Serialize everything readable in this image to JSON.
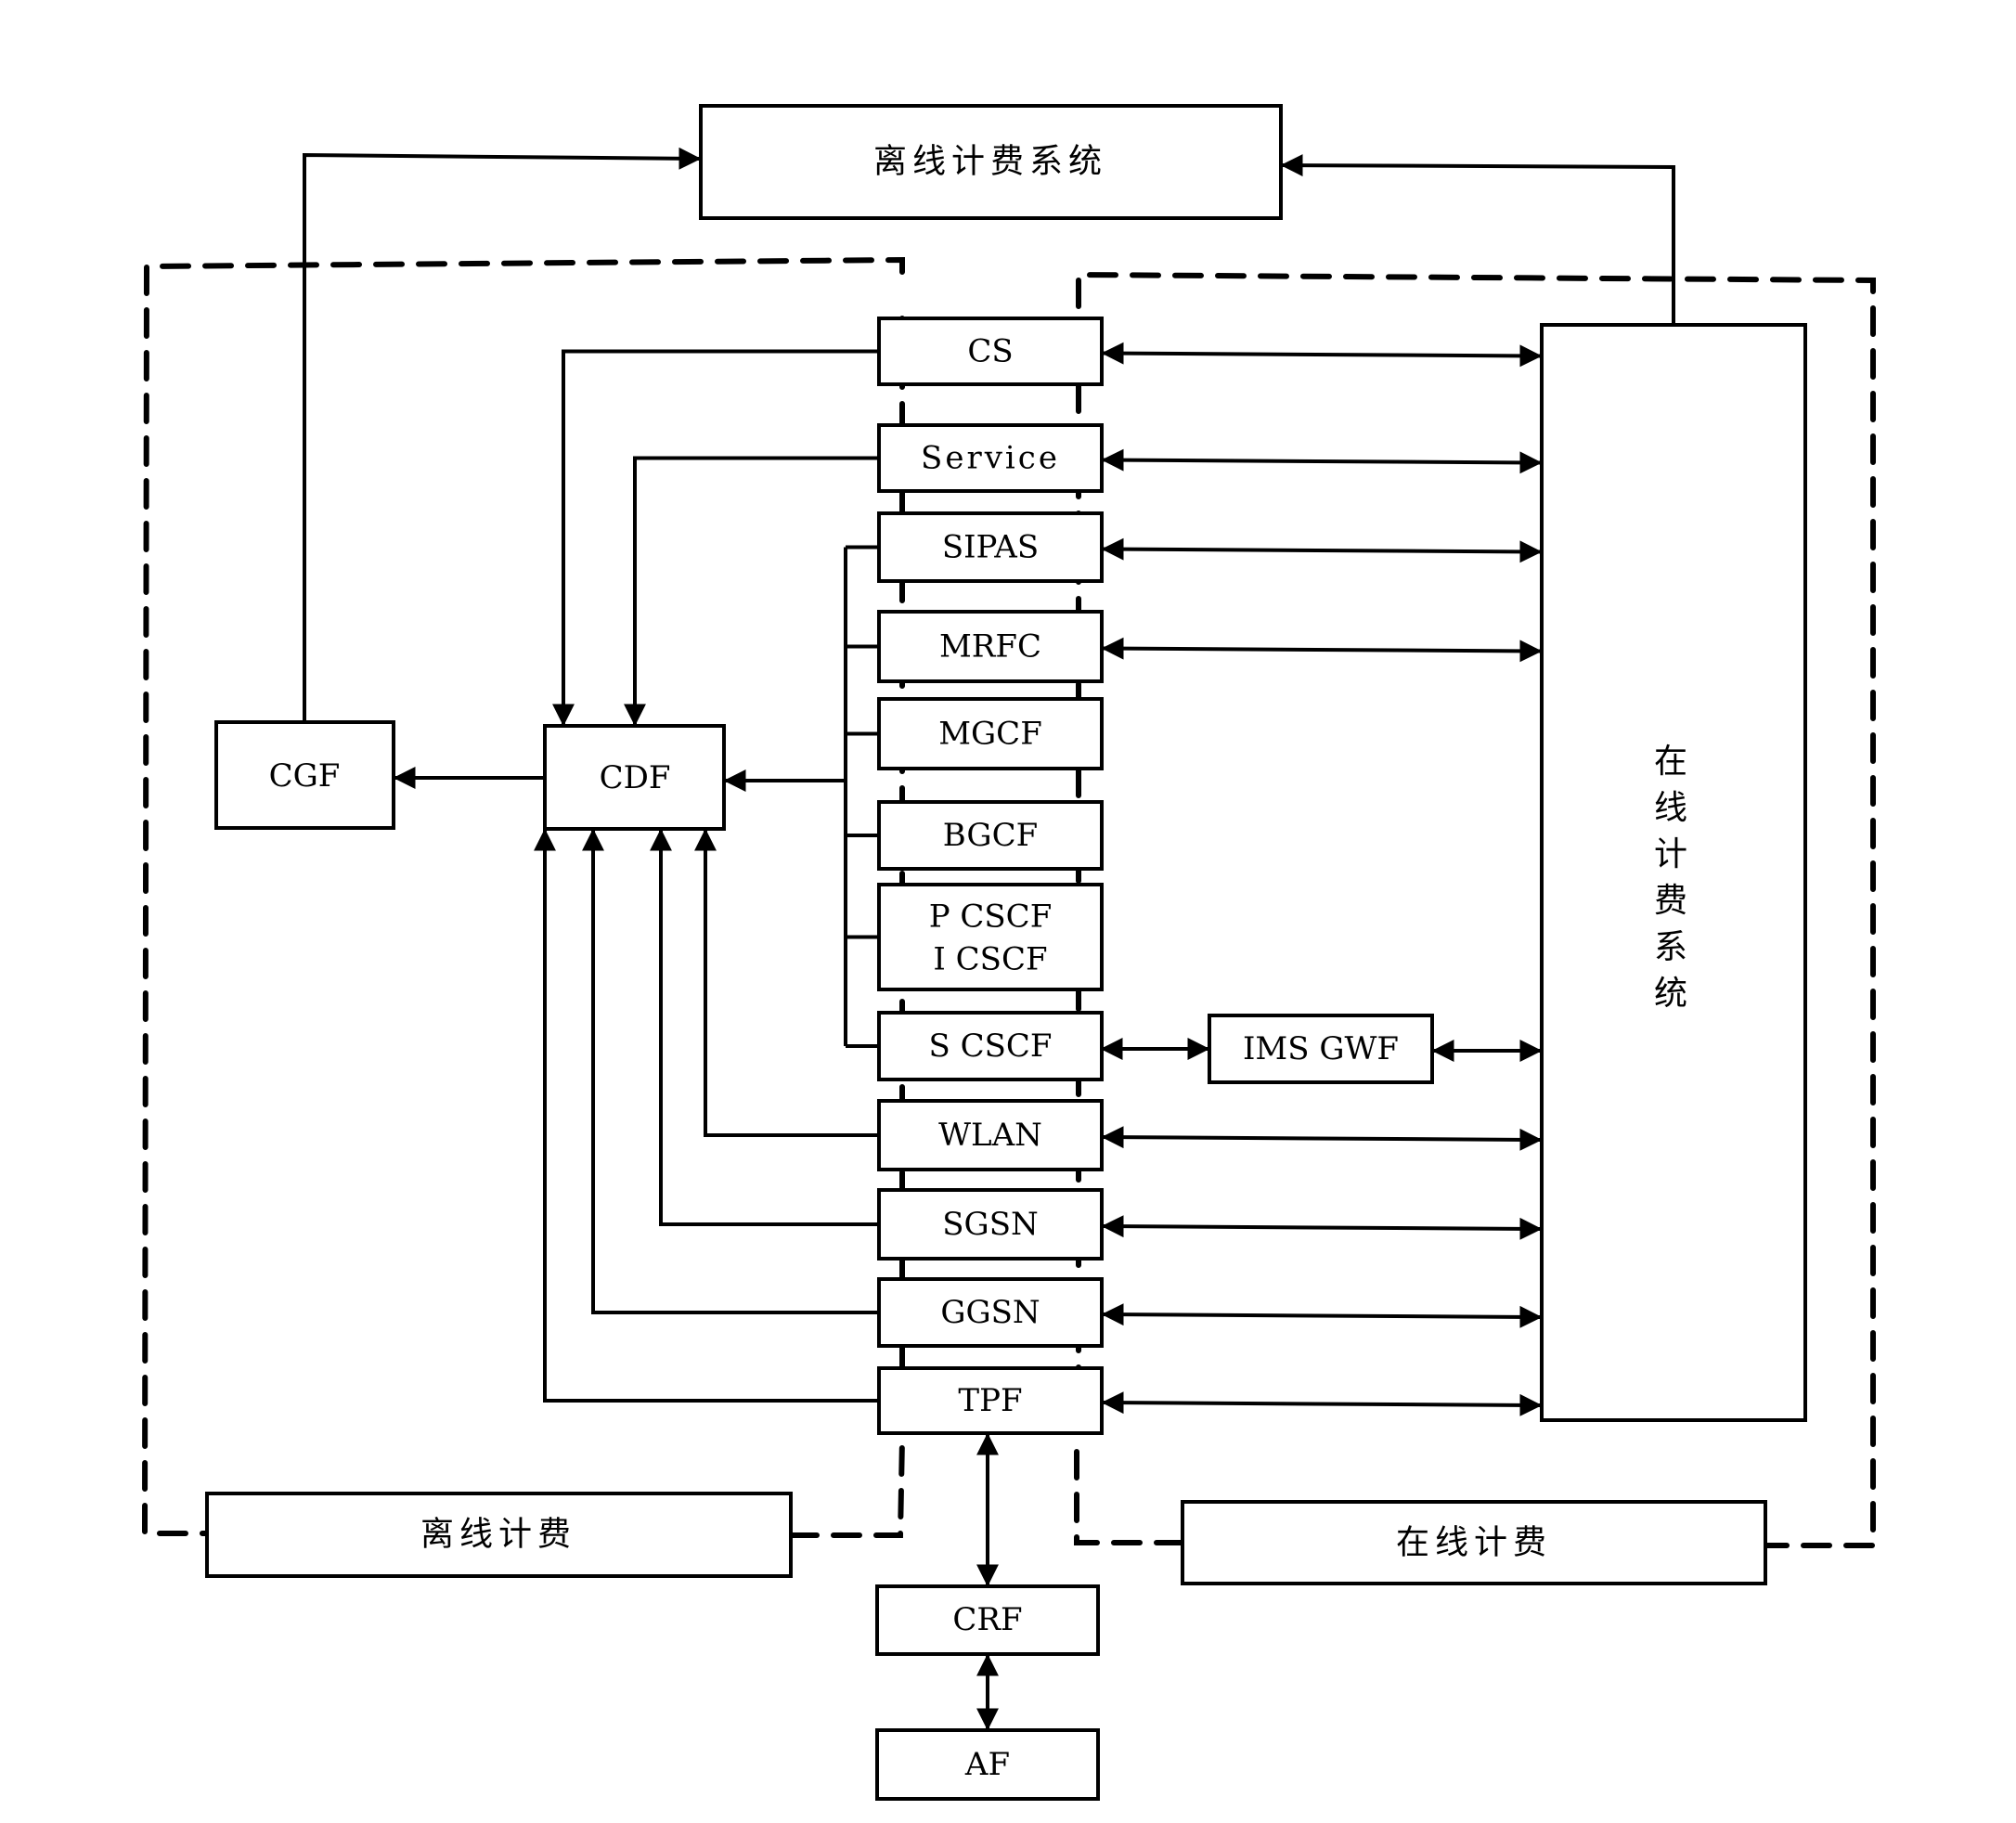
{
  "diagram": {
    "offline_system": "离线计费系统",
    "online_system": "在线计费系统",
    "offline_charging": "离线计费",
    "online_charging": "在线计费",
    "cgf": "CGF",
    "cdf": "CDF",
    "ims_gwf": "IMS GWF",
    "crf": "CRF",
    "af": "AF",
    "nodes": [
      {
        "id": "cs",
        "label": "CS"
      },
      {
        "id": "service",
        "label": "Service"
      },
      {
        "id": "sipas",
        "label": "SIPAS"
      },
      {
        "id": "mrfc",
        "label": "MRFC"
      },
      {
        "id": "mgcf",
        "label": "MGCF"
      },
      {
        "id": "bgcf",
        "label": "BGCF"
      },
      {
        "id": "pi-cscf",
        "label": "P CSCF",
        "label2": "I CSCF"
      },
      {
        "id": "s-cscf",
        "label": "S CSCF"
      },
      {
        "id": "wlan",
        "label": "WLAN"
      },
      {
        "id": "sgsn",
        "label": "SGSN"
      },
      {
        "id": "ggsn",
        "label": "GGSN"
      },
      {
        "id": "tpf",
        "label": "TPF"
      }
    ],
    "online_links": [
      "cs",
      "service",
      "sipas",
      "mrfc",
      "wlan",
      "sgsn",
      "ggsn",
      "tpf"
    ],
    "bus_links_to_cdf": [
      "sipas",
      "mrfc",
      "mgcf",
      "bgcf",
      "pi-cscf",
      "s-cscf"
    ],
    "direct_links_to_cdf": [
      "cs",
      "service",
      "wlan",
      "sgsn",
      "ggsn",
      "tpf"
    ]
  }
}
